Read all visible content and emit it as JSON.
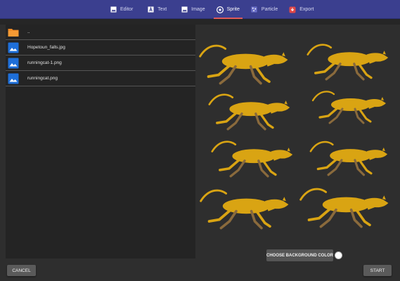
{
  "tabs": [
    {
      "label": "Editor",
      "icon": "image-icon"
    },
    {
      "label": "Text",
      "icon": "text-icon"
    },
    {
      "label": "Image",
      "icon": "image-icon"
    },
    {
      "label": "Sprite",
      "icon": "sprite-icon",
      "active": true
    },
    {
      "label": "Particle",
      "icon": "particle-icon"
    },
    {
      "label": "Export",
      "icon": "export-icon"
    }
  ],
  "files": [
    {
      "name": "..",
      "icon": "folder-icon"
    },
    {
      "name": "Hopetoun_falls.jpg",
      "icon": "image-file-icon"
    },
    {
      "name": "runningcat-1.png",
      "icon": "image-file-icon"
    },
    {
      "name": "runningcat.png",
      "icon": "image-file-icon"
    }
  ],
  "actions": {
    "choose_bg": "CHOOSE BACKGROUND COLOR",
    "cancel": "CANCEL",
    "start": "START"
  },
  "colors": {
    "topbar": "#3b3f8f",
    "active_underline": "#e05b5b",
    "cat": "#d9a413",
    "cat_dark": "#8a6a3c",
    "folder": "#f08a24",
    "file_icon": "#1e6fd9",
    "background_swatch": "#ffffff"
  },
  "sprite_frame_count": 8
}
